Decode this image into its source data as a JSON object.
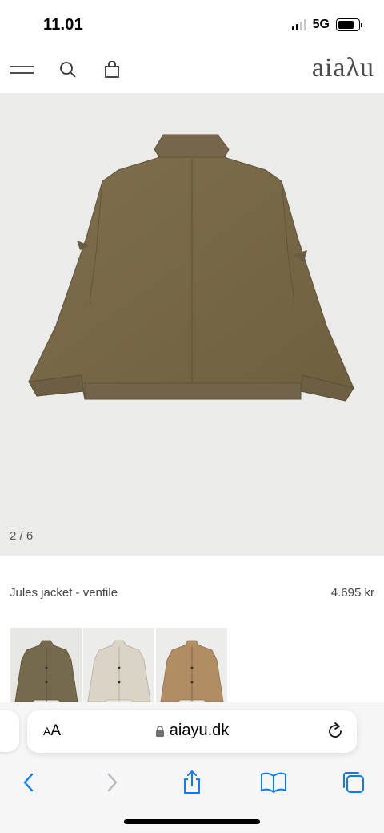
{
  "status_bar": {
    "time": "11.01",
    "network": "5G",
    "signal_bars_active": 2,
    "battery_level": 0.8
  },
  "header": {
    "logo": "aiaλu",
    "icons": [
      "menu-icon",
      "search-icon",
      "shopping-bag-icon"
    ]
  },
  "product": {
    "image_counter": "2 / 6",
    "name": "Jules jacket - ventile",
    "price": "4.695 kr",
    "jacket_color": "#7a6a4a",
    "variants": [
      {
        "color": "#766a4c",
        "name": "olive"
      },
      {
        "color": "#d9d4c6",
        "name": "stone"
      },
      {
        "color": "#b08d63",
        "name": "tan"
      }
    ]
  },
  "safari": {
    "aa_label_small": "A",
    "aa_label_large": "A",
    "url": "aiayu.dk",
    "accent_color": "#0a7aff",
    "toolbar_icons": [
      "back-icon",
      "forward-icon",
      "share-icon",
      "bookmarks-icon",
      "tabs-icon"
    ]
  }
}
